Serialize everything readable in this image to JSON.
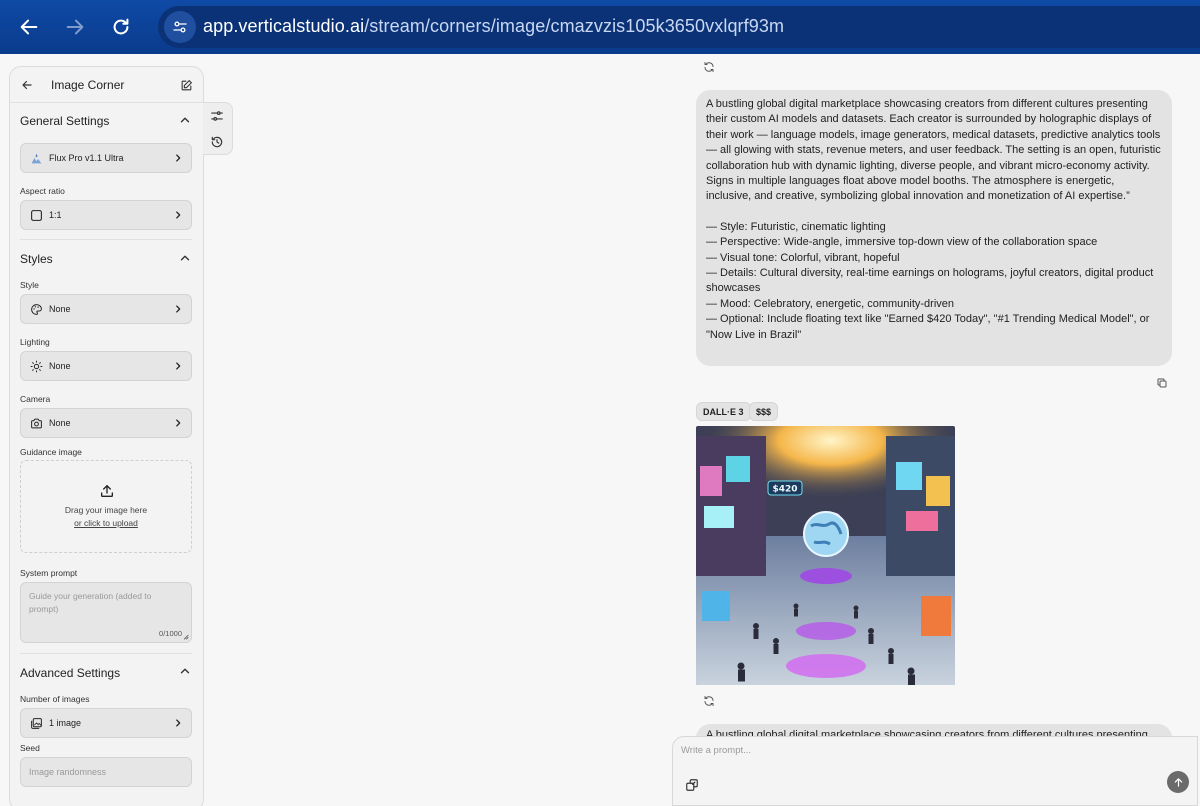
{
  "browser": {
    "url_host": "app.verticalstudio.ai",
    "url_path": "/stream/corners/image/cmazvzis105k3650vxlqrf93m"
  },
  "sidebar": {
    "title": "Image Corner",
    "general_settings": {
      "heading": "General Settings",
      "model": "Flux Pro v1.1 Ultra",
      "aspect_ratio_label": "Aspect ratio",
      "aspect_ratio": "1:1"
    },
    "styles": {
      "heading": "Styles",
      "style_label": "Style",
      "style_value": "None",
      "lighting_label": "Lighting",
      "lighting_value": "None",
      "camera_label": "Camera",
      "camera_value": "None",
      "guidance_label": "Guidance image",
      "dropzone_text": "Drag your image here",
      "dropzone_link": "or click to upload",
      "system_prompt_label": "System prompt",
      "system_prompt_placeholder": "Guide your generation (added to prompt)",
      "system_prompt_count": "0/1000"
    },
    "advanced": {
      "heading": "Advanced Settings",
      "num_images_label": "Number of images",
      "num_images_value": "1 image",
      "seed_label": "Seed",
      "seed_placeholder": "Image randomness"
    }
  },
  "chat": {
    "prompt_paragraph": "A bustling global digital marketplace showcasing creators from different cultures presenting their custom AI models and datasets. Each creator is surrounded by holographic displays of their work — language models, image generators, medical datasets, predictive analytics tools — all glowing with stats, revenue meters, and user feedback. The setting is an open, futuristic collaboration hub with dynamic lighting, diverse people, and vibrant micro-economy activity. Signs in multiple languages float above model booths. The atmosphere is energetic, inclusive, and creative, symbolizing global innovation and monetization of AI expertise.”",
    "prompt_style": "— Style: Futuristic, cinematic lighting",
    "prompt_perspective": "— Perspective: Wide-angle, immersive top-down view of the collaboration space",
    "prompt_tone": "— Visual tone: Colorful, vibrant, hopeful",
    "prompt_details": "— Details: Cultural diversity, real-time earnings on holograms, joyful creators, digital product showcases",
    "prompt_mood": "— Mood: Celebratory, energetic, community-driven",
    "prompt_optional": "— Optional: Include floating text like \"Earned $420 Today\", \"#1 Trending Medical Model\", or \"Now Live in Brazil\"",
    "model_badge": "DALL·E 3",
    "price_badge": "$$$",
    "image_sign_text": "$420",
    "next_prompt_preview": "A bustling global digital marketplace showcasing creators from different cultures presenting"
  },
  "composer": {
    "placeholder": "Write a prompt..."
  }
}
